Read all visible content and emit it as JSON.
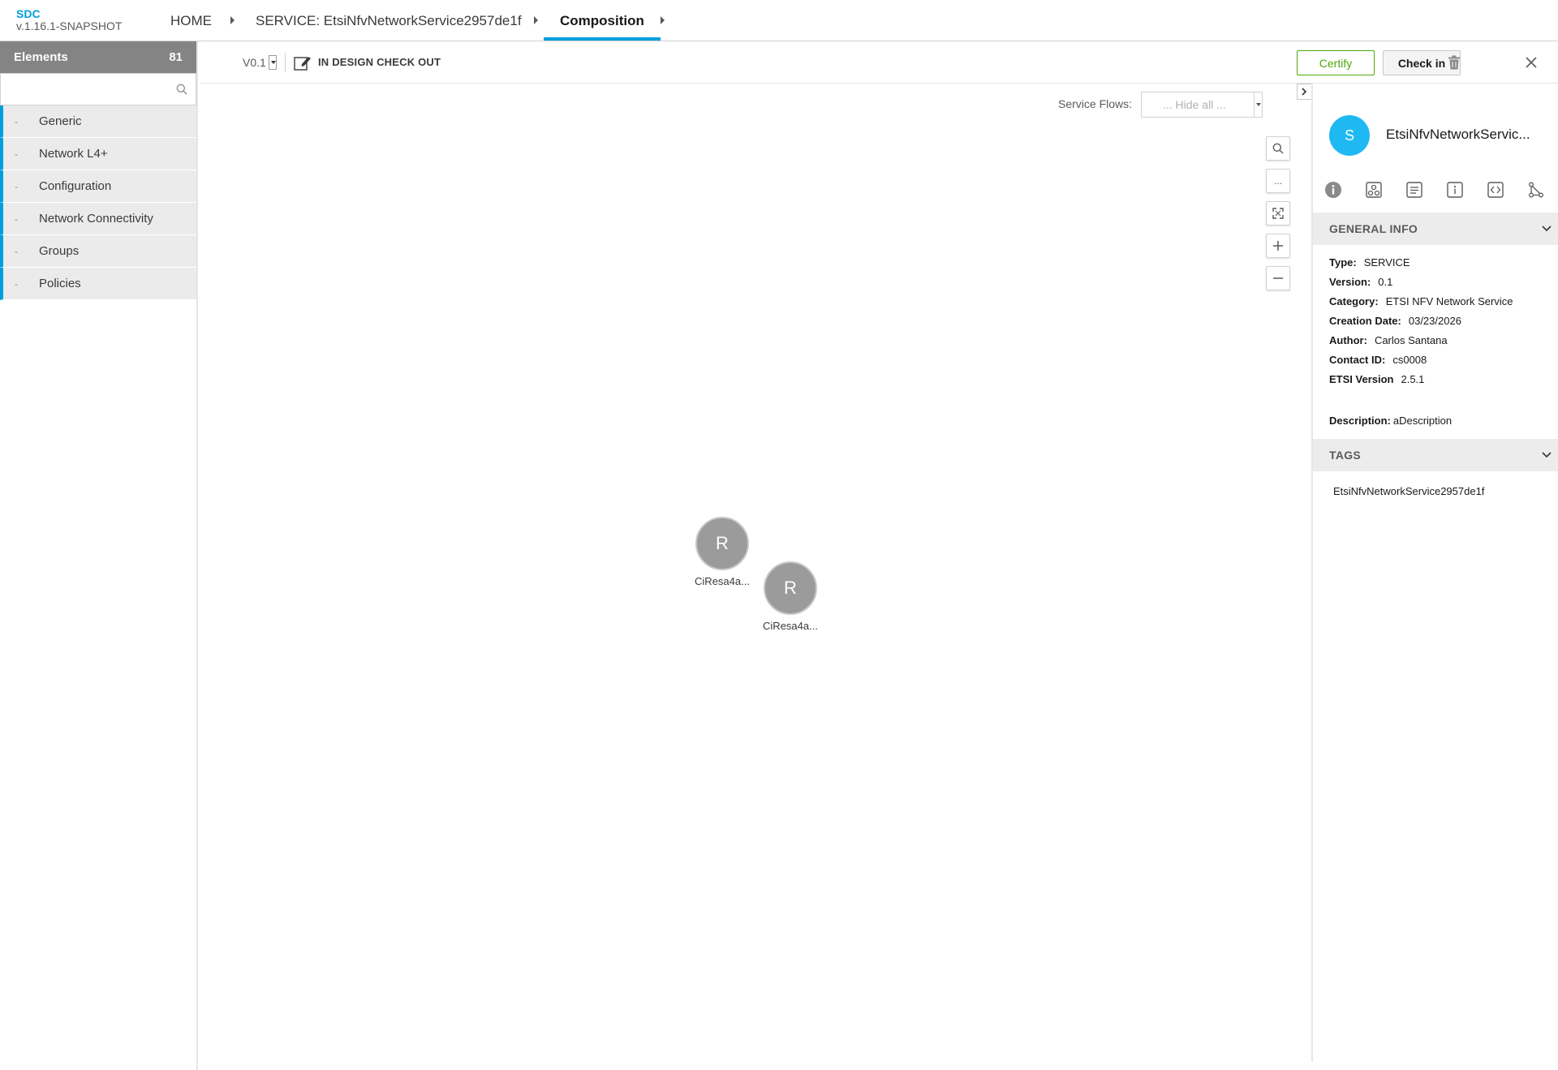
{
  "header": {
    "app_name": "SDC",
    "app_version": "v.1.16.1-SNAPSHOT",
    "breadcrumbs": [
      "HOME",
      "SERVICE: EtsiNfvNetworkService2957de1f",
      "Composition"
    ]
  },
  "palette": {
    "title": "Elements",
    "count": "81",
    "search_placeholder": "",
    "dash": "-",
    "groups": [
      "Generic",
      "Network L4+",
      "Configuration",
      "Network Connectivity",
      "Groups",
      "Policies"
    ]
  },
  "workspace": {
    "version": "V0.1",
    "status": "IN DESIGN CHECK OUT",
    "certify_label": "Certify",
    "checkin_label": "Check in"
  },
  "canvas": {
    "service_flows_label": "Service Flows:",
    "service_flows_value": "... Hide all ...",
    "zoom_more_glyph": "...",
    "nodes": [
      {
        "letter": "R",
        "label": "CiResa4a..."
      },
      {
        "letter": "R",
        "label": "CiResa4a..."
      }
    ]
  },
  "details": {
    "avatar_letter": "S",
    "name": "EtsiNfvNetworkServic...",
    "general_info_title": "GENERAL INFO",
    "fields": [
      {
        "key": "Type:",
        "value": "SERVICE"
      },
      {
        "key": "Version:",
        "value": "0.1"
      },
      {
        "key": "Category:",
        "value": "ETSI NFV Network Service"
      },
      {
        "key": "Creation Date:",
        "value": "03/23/2026"
      },
      {
        "key": "Author:",
        "value": "Carlos Santana"
      },
      {
        "key": "Contact ID:",
        "value": "cs0008"
      },
      {
        "key": "ETSI Version",
        "value": "2.5.1"
      }
    ],
    "description_key": "Description:",
    "description_value": "aDescription",
    "tags_title": "TAGS",
    "tags": [
      "EtsiNfvNetworkService2957de1f"
    ]
  },
  "colors": {
    "accent": "#009fdb",
    "certify_green": "#4ca90c",
    "avatar_blue": "#1eb9f3",
    "node_gray": "#9b9b9b"
  },
  "icons": [
    "search-icon",
    "edit-checkout-icon",
    "trash-icon",
    "close-icon",
    "zoom-search-icon",
    "more-icon",
    "fit-icon",
    "zoom-in-icon",
    "zoom-out-icon",
    "collapse-icon",
    "info-tab-icon",
    "deployment-tab-icon",
    "properties-tab-icon",
    "attributes-tab-icon",
    "api-tab-icon",
    "paths-tab-icon",
    "chevron-down-icon"
  ]
}
